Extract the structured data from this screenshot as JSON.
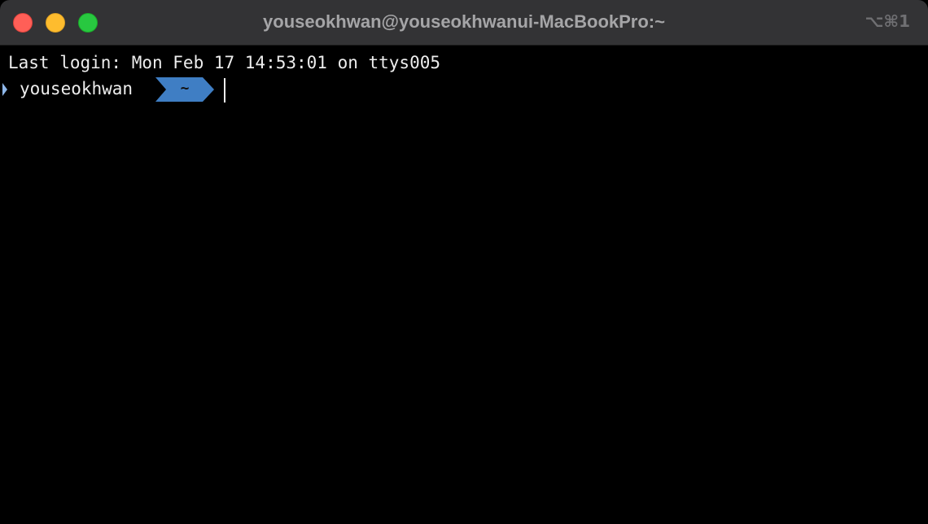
{
  "window": {
    "title": "youseokhwan@youseokhwanui-MacBookPro:~",
    "shortcut": "⌥⌘1",
    "controls": [
      "close",
      "minimize",
      "maximize"
    ]
  },
  "terminal": {
    "last_login": "Last login: Mon Feb 17 14:53:01 on ttys005",
    "prompt": {
      "user": "youseokhwan",
      "directory": "~",
      "arrow_icon": "prompt-arrow-icon",
      "segment_color": "#3f7ec4"
    }
  },
  "colors": {
    "background": "#000000",
    "titlebar": "#333335",
    "close": "#ff5f57",
    "minimize": "#febc2e",
    "maximize": "#28c840"
  }
}
